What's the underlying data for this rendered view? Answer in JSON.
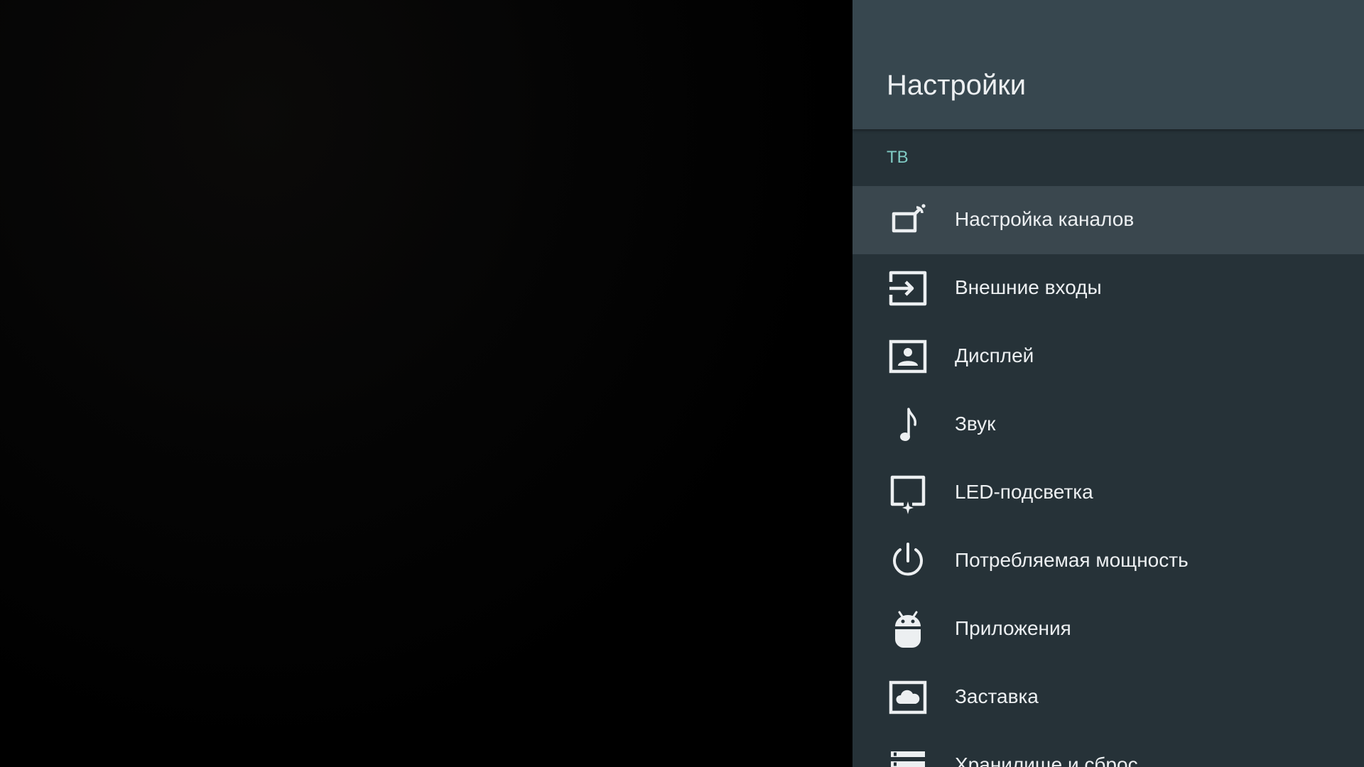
{
  "panel": {
    "title": "Настройки",
    "section": "ТВ",
    "items": [
      {
        "label": "Настройка каналов",
        "icon": "channel-setup-icon",
        "selected": true
      },
      {
        "label": "Внешние входы",
        "icon": "input-icon",
        "selected": false
      },
      {
        "label": "Дисплей",
        "icon": "display-icon",
        "selected": false
      },
      {
        "label": "Звук",
        "icon": "music-note-icon",
        "selected": false
      },
      {
        "label": "LED-подсветка",
        "icon": "led-backlight-icon",
        "selected": false
      },
      {
        "label": "Потребляемая мощность",
        "icon": "power-icon",
        "selected": false
      },
      {
        "label": "Приложения",
        "icon": "android-icon",
        "selected": false
      },
      {
        "label": "Заставка",
        "icon": "screensaver-icon",
        "selected": false
      },
      {
        "label": "Хранилище и сброс",
        "icon": "storage-icon",
        "selected": false
      }
    ]
  },
  "colors": {
    "header_bg": "#37474f",
    "panel_bg": "#263238",
    "selected_bg": "#3a474e",
    "accent": "#80cbc4",
    "text": "#eceff1"
  }
}
